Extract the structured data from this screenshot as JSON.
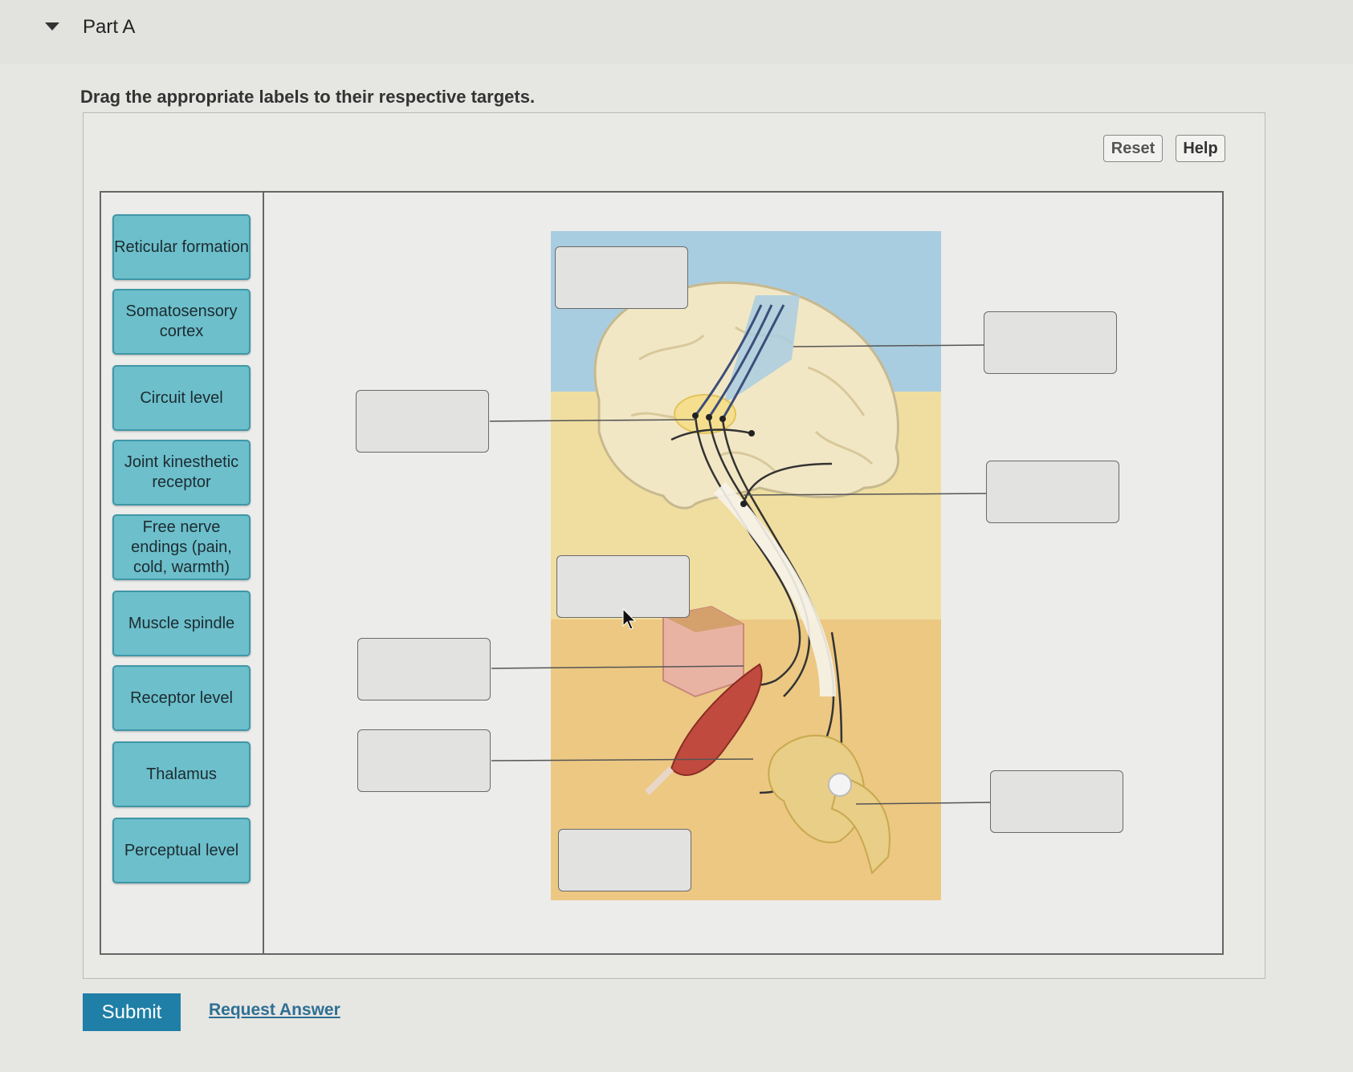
{
  "part": {
    "title": "Part A",
    "collapse_icon": "caret-down-icon"
  },
  "instruction": "Drag the appropriate labels to their respective targets.",
  "toolbar": {
    "reset_label": "Reset",
    "help_label": "Help"
  },
  "labels": [
    "Reticular formation",
    "Somatosensory cortex",
    "Circuit level",
    "Joint kinesthetic receptor",
    "Free nerve endings (pain, cold, warmth)",
    "Muscle spindle",
    "Receptor level",
    "Thalamus",
    "Perceptual level"
  ],
  "drop_targets": [
    {
      "id": "top-cortex-region",
      "value": ""
    },
    {
      "id": "somatosensory-area",
      "value": ""
    },
    {
      "id": "thalamus-point",
      "value": ""
    },
    {
      "id": "brainstem-region",
      "value": ""
    },
    {
      "id": "spinal-region",
      "value": ""
    },
    {
      "id": "skin-receptor",
      "value": ""
    },
    {
      "id": "muscle-receptor",
      "value": ""
    },
    {
      "id": "joint-receptor",
      "value": ""
    },
    {
      "id": "bottom-region",
      "value": ""
    }
  ],
  "colors": {
    "label_fill": "#6cbfcb",
    "label_border": "#3f97a6",
    "submit_fill": "#1f7fa6",
    "sky_blue": "#a9cde0",
    "brain_zone": "#f0dea0",
    "body_zone": "#ecc883"
  },
  "actions": {
    "submit_label": "Submit",
    "request_answer_label": "Request Answer"
  }
}
